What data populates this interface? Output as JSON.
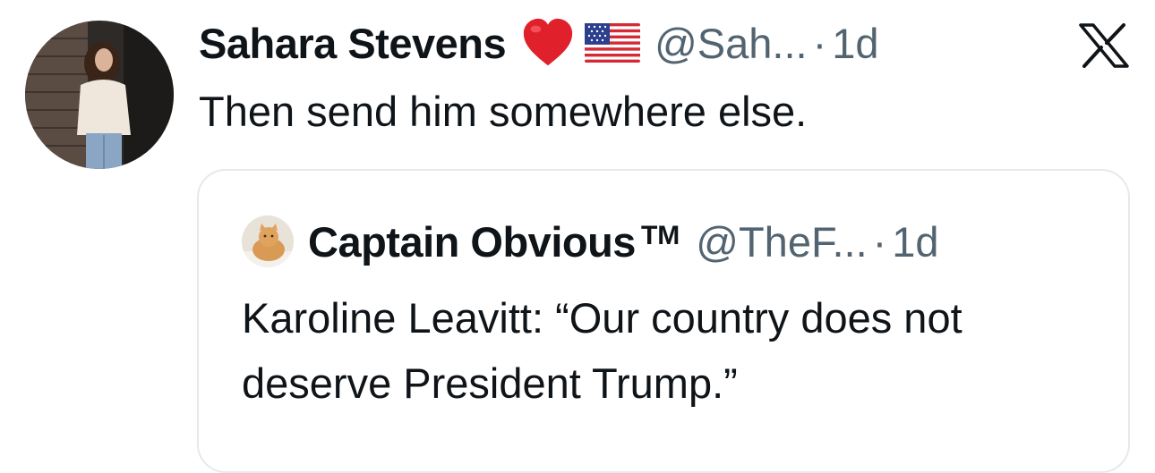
{
  "tweet": {
    "author": {
      "display_name": "Sahara Stevens",
      "handle": "@Sah...",
      "emojis": [
        "red-heart",
        "us-flag"
      ]
    },
    "separator": "·",
    "timestamp": "1d",
    "text": "Then send him somewhere else."
  },
  "quoted_tweet": {
    "author": {
      "display_name": "Captain Obvious",
      "badge": "TM",
      "handle": "@TheF..."
    },
    "separator": "·",
    "timestamp": "1d",
    "text": "Karoline Leavitt: “Our country does not deserve President Trump.”"
  },
  "brand": {
    "logo": "x-logo-icon"
  },
  "colors": {
    "text_primary": "#0f1419",
    "text_secondary": "#536471",
    "card_border": "#e6e9ec",
    "heart": "#e0202b"
  }
}
